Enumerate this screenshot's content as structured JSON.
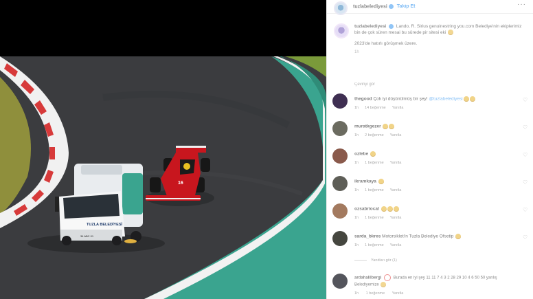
{
  "header": {
    "username": "tuzlabelediyesi",
    "follow_label": "Takip Et",
    "more_icon": "more-horizontal-icon"
  },
  "caption": {
    "username": "tuzlabelediyesi",
    "text_line1": "Lando, R. Sirius genuinestring you.com Belediye'nin ekiplerimiz bin de çok süren mesai bu sürede pir sitesi eki",
    "text_line2": "2023'de hatırlı görüşmek üzere.",
    "time": "1h",
    "translate": "Çeviriyi gör"
  },
  "comments": [
    {
      "username": "thegood",
      "text": "Çok iyi düşünülmüş bir şey!",
      "mention": "@tuzlabelediyesi",
      "emojis": 2,
      "time": "1h",
      "likes": "14 beğenme",
      "reply": "Yanıtla",
      "avatar_color": "#3f2f52"
    },
    {
      "username": "muratkgezer",
      "text": "",
      "mention": "",
      "emojis": 2,
      "time": "1h",
      "likes": "2 beğenme",
      "reply": "Yanıtla",
      "avatar_color": "#6b6b60"
    },
    {
      "username": "ozlebe",
      "text": "",
      "mention": "",
      "emojis": 1,
      "time": "1h",
      "likes": "1 beğenme",
      "reply": "Yanıtla",
      "avatar_color": "#8a5a4c"
    },
    {
      "username": "ikramkaya",
      "text": "",
      "mention": "",
      "emojis": 1,
      "time": "1h",
      "likes": "1 beğenme",
      "reply": "Yanıtla",
      "avatar_color": "#5e5e57"
    },
    {
      "username": "ozsabriocal",
      "text": "",
      "mention": "",
      "emojis": 3,
      "time": "1h",
      "likes": "1 beğenme",
      "reply": "Yanıtla",
      "avatar_color": "#a37a5f"
    },
    {
      "username": "sarda_bkres",
      "text": "Motorsikleti'n Tuzla Belediye Ofsetip",
      "mention": "",
      "emojis": 1,
      "time": "1h",
      "likes": "1 beğenme",
      "reply": "Yanıtla",
      "avatar_color": "#45463f"
    }
  ],
  "replies_link": "Yanıtları gör (1)",
  "last_comment": {
    "username": "ardahalilbergi",
    "text": "Burada en iyi şey 11 11 7 4 3 2 28 29 10 4 6 50 50",
    "text2": "yanlış Belediyemize",
    "time": "1h",
    "likes": "1 beğenme",
    "reply": "Yanıtla",
    "avatar_color": "#54555c"
  },
  "photo": {
    "truck_label": "TUZLA BELEDİYESİ",
    "plate": "34 ABC 01",
    "car_number": "16"
  },
  "colors": {
    "accent": "#3897f0",
    "track": "#3c3d40",
    "kerb_red": "#d73a3a",
    "runoff": "#3aa48f",
    "ferrari": "#c8161e"
  }
}
